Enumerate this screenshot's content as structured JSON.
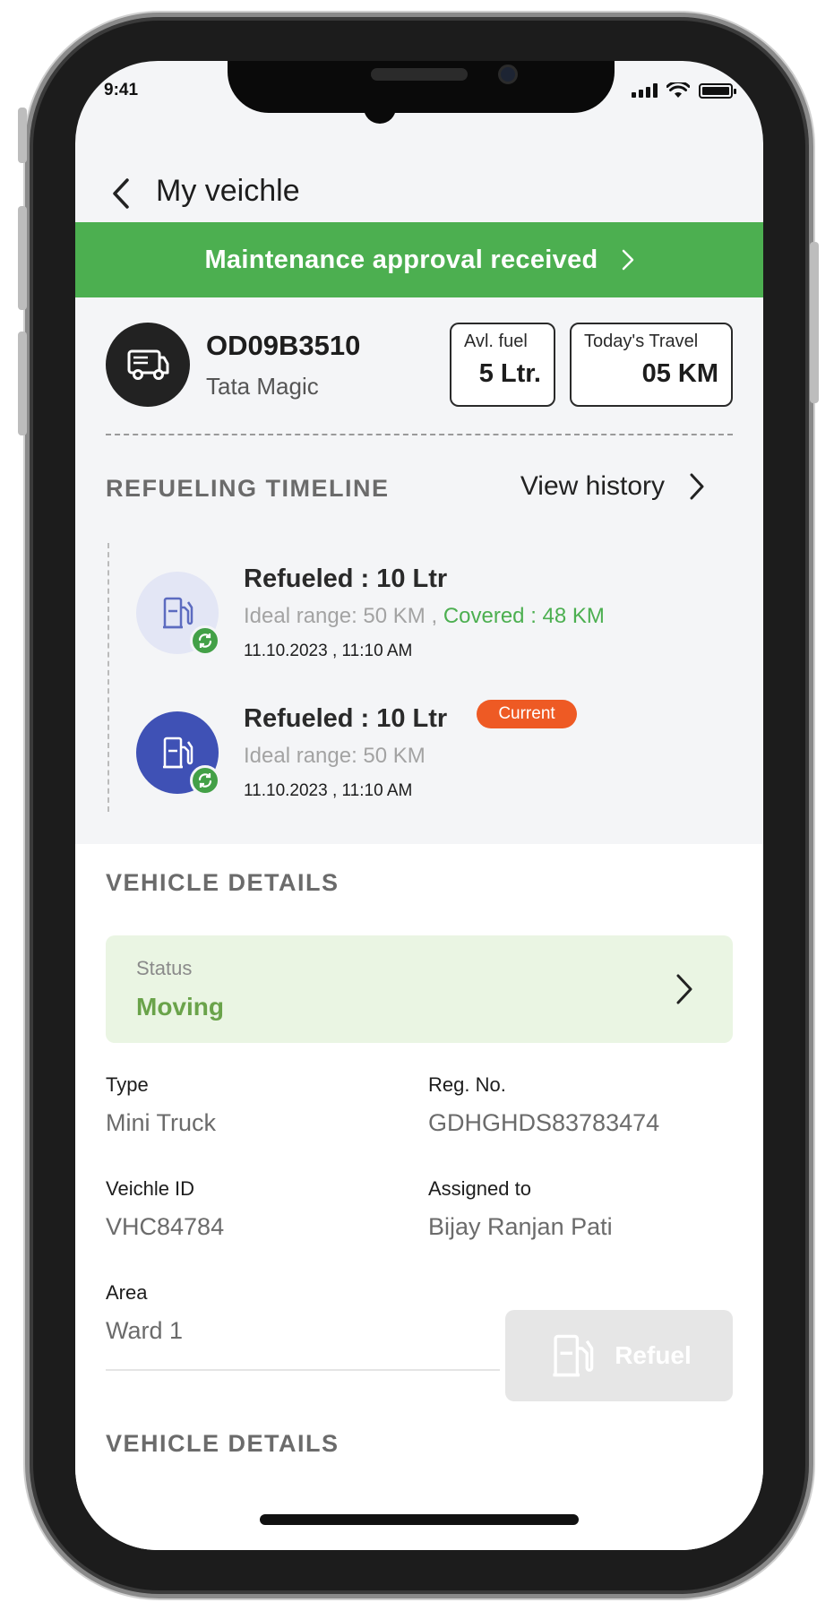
{
  "status_bar": {
    "time": "9:41"
  },
  "header": {
    "title": "My veichle"
  },
  "banner": {
    "text": "Maintenance approval received"
  },
  "vehicle": {
    "id": "OD09B3510",
    "model": "Tata Magic",
    "fuel": {
      "label": "Avl. fuel",
      "value": "5 Ltr."
    },
    "travel": {
      "label": "Today's Travel",
      "value": "05 KM"
    }
  },
  "timeline": {
    "title": "REFUELING TIMELINE",
    "view_history": "View history",
    "entries": [
      {
        "title": "Refueled : 10 Ltr",
        "range": "Ideal range: 50 KM ,",
        "covered": "Covered : 48 KM",
        "date": "11.10.2023 , 11:10 AM"
      },
      {
        "title": "Refueled : 10 Ltr",
        "badge": "Current",
        "range": "Ideal range: 50 KM",
        "date": "11.10.2023 , 11:10 AM"
      }
    ]
  },
  "details": {
    "title": "VEHICLE DETAILS",
    "status": {
      "label": "Status",
      "value": "Moving"
    },
    "type": {
      "label": "Type",
      "value": "Mini Truck"
    },
    "reg": {
      "label": "Reg. No.",
      "value": "GDHGHDS83783474"
    },
    "vehicle_id": {
      "label": "Veichle ID",
      "value": "VHC84784"
    },
    "assigned": {
      "label": "Assigned to",
      "value": "Bijay Ranjan Pati"
    },
    "area": {
      "label": "Area",
      "value": "Ward 1"
    }
  },
  "refuel_button": {
    "label": "Refuel"
  },
  "second_section": {
    "title": "VEHICLE DETAILS"
  },
  "colors": {
    "accent_green": "#4caf50",
    "status_green": "#6aa34a",
    "timeline_blue": "#3f51b5",
    "current_orange": "#ee5a24"
  },
  "icons": [
    "back-icon",
    "chevron-right-icon",
    "truck-icon",
    "fuel-pump-icon",
    "refresh-icon",
    "signal-icon",
    "wifi-icon",
    "battery-icon"
  ]
}
